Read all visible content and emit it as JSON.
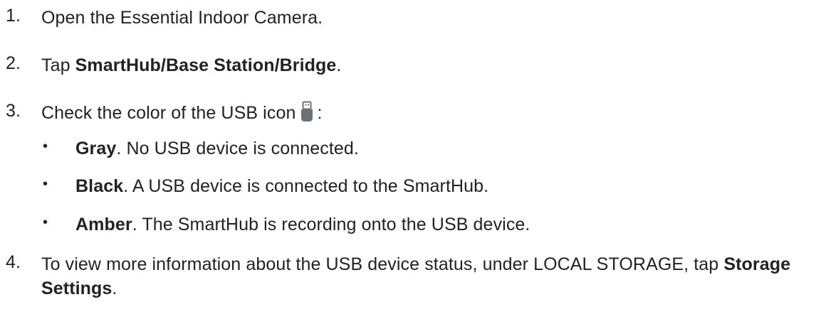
{
  "steps": [
    {
      "number": "1.",
      "text": "Open the Essential Indoor Camera."
    },
    {
      "number": "2.",
      "prefix": "Tap ",
      "bold": "SmartHub/Base Station/Bridge",
      "suffix": "."
    },
    {
      "number": "3.",
      "text": "Check the color of the USB icon",
      "after_icon": ":",
      "icon": "usb-drive-icon"
    },
    {
      "number": "4.",
      "text": "To view more information about the USB device status, under LOCAL STORAGE, tap ",
      "bold": "Storage Settings",
      "suffix": "."
    }
  ],
  "bullets": [
    {
      "marker": "•",
      "bold": "Gray",
      "text": ". No USB device is connected."
    },
    {
      "marker": "•",
      "bold": "Black",
      "text": ". A USB device is connected to the SmartHub."
    },
    {
      "marker": "•",
      "bold": "Amber",
      "text": ". The SmartHub is recording onto the USB device."
    }
  ],
  "colors": {
    "text": "#222222",
    "icon_body": "#6b6f76",
    "icon_cap": "#ffffff"
  }
}
